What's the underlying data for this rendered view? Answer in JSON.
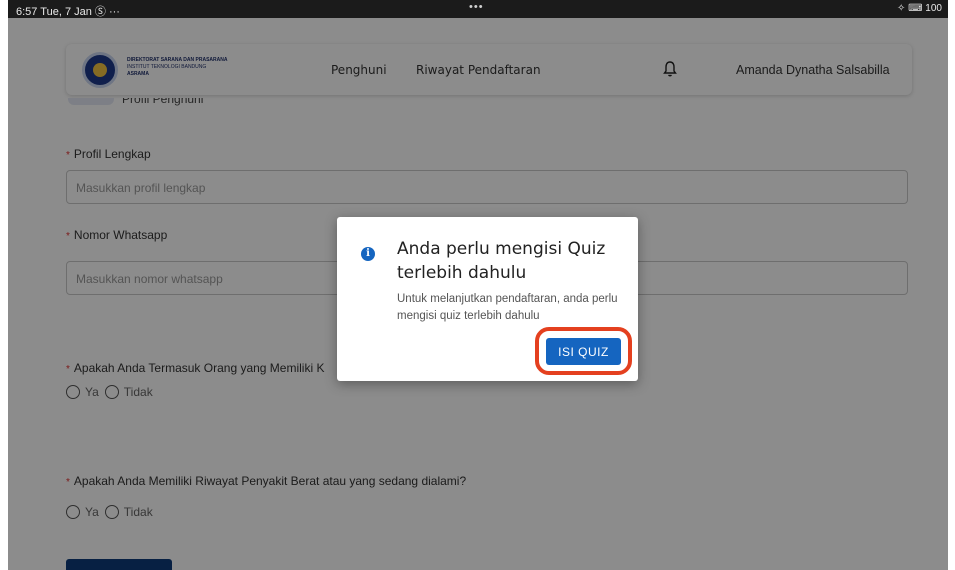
{
  "status_bar": {
    "time": "6:57",
    "date": "Tue, 7 Jan",
    "extra": "Ⓢ ···",
    "center": "•••",
    "icons": "✧ ⌨ 100"
  },
  "navbar": {
    "logo_line1": "DIREKTORAT SARANA DAN PRASARANA",
    "logo_line2": "INSTITUT TEKNOLOGI BANDUNG",
    "logo_line3": "ASRAMA",
    "links": [
      "Penghuni",
      "Riwayat Pendaftaran"
    ],
    "user_name": "Amanda Dynatha Salsabilla"
  },
  "breadcrumb": {
    "partial_text": "Profil Penghuni"
  },
  "form": {
    "fields": [
      {
        "label": "Profil Lengkap",
        "placeholder": "Masukkan profil lengkap"
      },
      {
        "label": "Nomor Whatsapp",
        "placeholder": "Masukkan nomor whatsapp"
      }
    ],
    "questions": [
      {
        "label": "Apakah Anda Termasuk Orang yang Memiliki K",
        "options": [
          "Ya",
          "Tidak"
        ]
      },
      {
        "label": "Apakah Anda Memiliki Riwayat Penyakit Berat atau yang sedang dialami?",
        "options": [
          "Ya",
          "Tidak"
        ]
      }
    ]
  },
  "modal": {
    "icon": "info-icon",
    "title": "Anda perlu mengisi Quiz terlebih dahulu",
    "message": "Untuk melanjutkan pendaftaran, anda perlu mengisi quiz terlebih dahulu",
    "button_label": "ISI QUIZ",
    "highlight_color": "#e4401f",
    "button_color": "#1565c0"
  }
}
